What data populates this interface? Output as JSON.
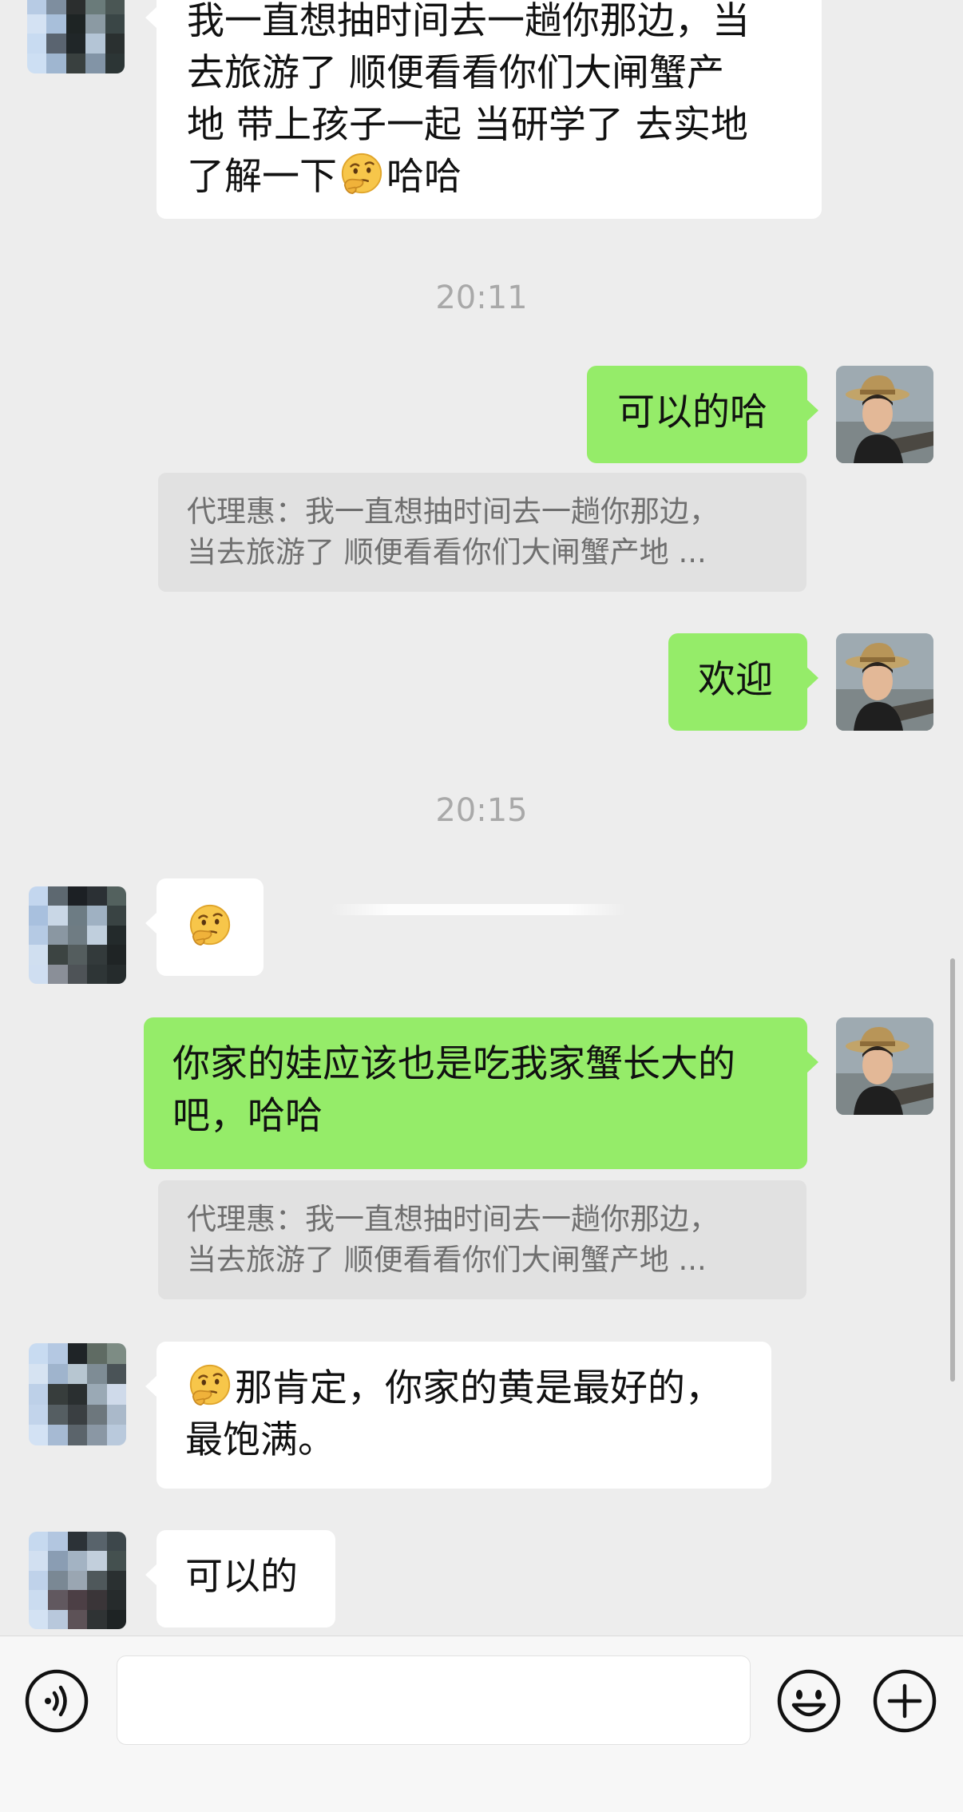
{
  "messages": {
    "m1": {
      "text_a": "我一直想抽时间去一趟你那边，当",
      "text_b": "去旅游了 顺便看看你们大闸蟹产",
      "text_c": "地  带上孩子一起 当研学了 去实地",
      "text_d_before": "了解一下",
      "text_d_after": "哈哈",
      "emoji": "thinking-face-emoji"
    },
    "time1": "20:11",
    "m2": {
      "text": "可以的哈"
    },
    "quote1": {
      "line1": "代理惠：我一直想抽时间去一趟你那边，",
      "line2": "当去旅游了 顺便看看你们大闸蟹产地  ..."
    },
    "m3": {
      "text": "欢迎"
    },
    "time2": "20:15",
    "m4": {
      "emoji": "thinking-face-emoji"
    },
    "m5": {
      "line1": "你家的娃应该也是吃我家蟹长大的",
      "line2": "吧，哈哈"
    },
    "quote2": {
      "line1": "代理惠：我一直想抽时间去一趟你那边，",
      "line2": "当去旅游了 顺便看看你们大闸蟹产地  ..."
    },
    "m6": {
      "line1": "那肯定，你家的黄是最好的，",
      "line2": "最饱满。",
      "emoji": "thinking-face-emoji"
    },
    "m7": {
      "text": "可以的"
    }
  },
  "toolbar": {
    "voice_icon": "voice-input-icon",
    "emoji_icon": "emoji-picker-icon",
    "plus_icon": "more-plus-icon",
    "input_value": ""
  },
  "colors": {
    "background": "#ededed",
    "outgoing_bubble": "#95ec69",
    "incoming_bubble": "#ffffff",
    "quote_bg": "#e1e1e1",
    "timestamp": "#a9a9a9"
  }
}
